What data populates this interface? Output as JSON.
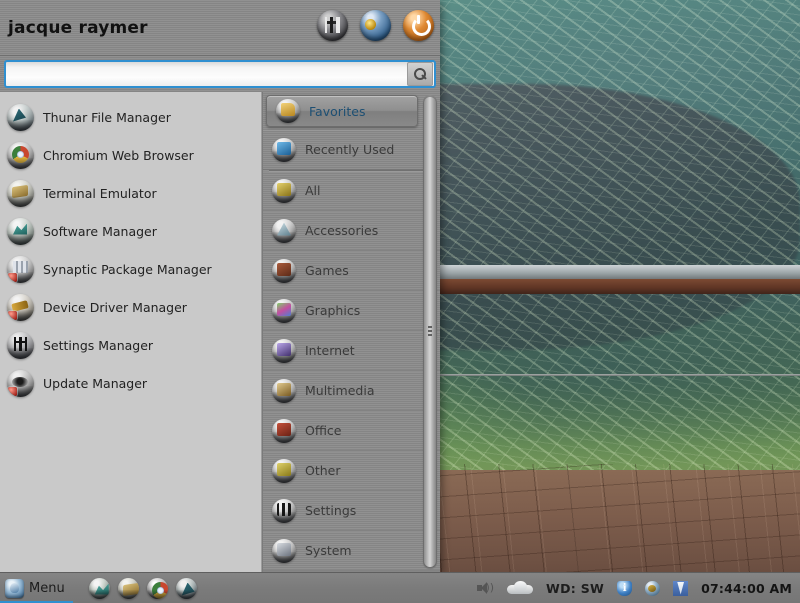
{
  "desktop": {
    "wallpaper_description": "underwater hippopotamus behind glass with brick patio and rusty railing",
    "colors": {
      "water_teal": "#45706e",
      "algae_green": "#7d9a5c",
      "brick": "#7d5d4c",
      "rust": "#5e3424"
    }
  },
  "menu": {
    "username": "jacque raymer",
    "header_icons": [
      {
        "name": "settings-manager-icon",
        "title": "Settings Manager"
      },
      {
        "name": "lock-screen-icon",
        "title": "Lock Screen"
      },
      {
        "name": "power-button-icon",
        "title": "Quit"
      }
    ],
    "search": {
      "value": "",
      "placeholder": "",
      "button_icon": "search-icon"
    },
    "favorites": {
      "items": [
        {
          "label": "Thunar File Manager",
          "icon": "thunar-icon"
        },
        {
          "label": "Chromium Web Browser",
          "icon": "chromium-icon"
        },
        {
          "label": "Terminal Emulator",
          "icon": "terminal-icon"
        },
        {
          "label": "Software Manager",
          "icon": "software-manager-icon"
        },
        {
          "label": "Synaptic Package Manager",
          "icon": "synaptic-icon"
        },
        {
          "label": "Device Driver Manager",
          "icon": "device-driver-icon"
        },
        {
          "label": "Settings Manager",
          "icon": "settings-manager-icon"
        },
        {
          "label": "Update Manager",
          "icon": "update-manager-icon"
        }
      ]
    },
    "categories": {
      "selected": "Favorites",
      "accent_color": "#1d4f73",
      "items": [
        {
          "label": "Favorites",
          "icon": "favorites-folder-icon",
          "selected": true
        },
        {
          "label": "Recently Used",
          "icon": "recently-used-icon",
          "selected": false
        },
        {
          "label": "All",
          "icon": "all-applications-icon",
          "selected": false
        },
        {
          "label": "Accessories",
          "icon": "accessories-icon",
          "selected": false
        },
        {
          "label": "Games",
          "icon": "games-icon",
          "selected": false
        },
        {
          "label": "Graphics",
          "icon": "graphics-icon",
          "selected": false
        },
        {
          "label": "Internet",
          "icon": "internet-icon",
          "selected": false
        },
        {
          "label": "Multimedia",
          "icon": "multimedia-icon",
          "selected": false
        },
        {
          "label": "Office",
          "icon": "office-icon",
          "selected": false
        },
        {
          "label": "Other",
          "icon": "other-icon",
          "selected": false
        },
        {
          "label": "Settings",
          "icon": "settings-icon",
          "selected": false
        },
        {
          "label": "System",
          "icon": "system-icon",
          "selected": false
        }
      ]
    }
  },
  "taskbar": {
    "menu_button": {
      "label": "Menu",
      "icon": "menu-orb-icon",
      "active": true,
      "indicator_color": "#2f8fd0"
    },
    "launchers": [
      {
        "name": "software-manager-launcher"
      },
      {
        "name": "terminal-launcher"
      },
      {
        "name": "chromium-launcher"
      },
      {
        "name": "thunar-launcher"
      }
    ],
    "tray": {
      "volume_icon": "speaker-icon",
      "weather_icon": "cloud-icon",
      "wind_label": "WD: SW",
      "icons": [
        {
          "name": "update-shield-icon"
        },
        {
          "name": "network-globe-icon"
        },
        {
          "name": "blue-tray-icon"
        }
      ],
      "clock": "07:44:00 AM"
    }
  }
}
